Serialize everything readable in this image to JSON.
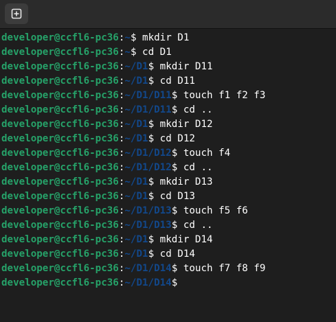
{
  "window": {
    "new_tab_icon": "new-tab-plus-icon"
  },
  "colors": {
    "background": "#1e1e1e",
    "prompt_user": "#26a269",
    "prompt_path": "#12488b",
    "text": "#ffffff"
  },
  "terminal": {
    "lines": [
      {
        "user": "developer@ccfl6-pc36",
        "path": "~",
        "sep": "$",
        "cmd": " mkdir D1"
      },
      {
        "user": "developer@ccfl6-pc36",
        "path": "~",
        "sep": "$",
        "cmd": " cd D1"
      },
      {
        "user": "developer@ccfl6-pc36",
        "path": "~/D1",
        "sep": "$",
        "cmd": " mkdir D11"
      },
      {
        "user": "developer@ccfl6-pc36",
        "path": "~/D1",
        "sep": "$",
        "cmd": " cd D11"
      },
      {
        "user": "developer@ccfl6-pc36",
        "path": "~/D1/D11",
        "sep": "$",
        "cmd": " touch f1 f2 f3"
      },
      {
        "user": "developer@ccfl6-pc36",
        "path": "~/D1/D11",
        "sep": "$",
        "cmd": " cd .."
      },
      {
        "user": "developer@ccfl6-pc36",
        "path": "~/D1",
        "sep": "$",
        "cmd": " mkdir D12"
      },
      {
        "user": "developer@ccfl6-pc36",
        "path": "~/D1",
        "sep": "$",
        "cmd": " cd D12"
      },
      {
        "user": "developer@ccfl6-pc36",
        "path": "~/D1/D12",
        "sep": "$",
        "cmd": " touch f4"
      },
      {
        "user": "developer@ccfl6-pc36",
        "path": "~/D1/D12",
        "sep": "$",
        "cmd": " cd .."
      },
      {
        "user": "developer@ccfl6-pc36",
        "path": "~/D1",
        "sep": "$",
        "cmd": " mkdir D13"
      },
      {
        "user": "developer@ccfl6-pc36",
        "path": "~/D1",
        "sep": "$",
        "cmd": " cd D13"
      },
      {
        "user": "developer@ccfl6-pc36",
        "path": "~/D1/D13",
        "sep": "$",
        "cmd": " touch f5 f6"
      },
      {
        "user": "developer@ccfl6-pc36",
        "path": "~/D1/D13",
        "sep": "$",
        "cmd": " cd .."
      },
      {
        "user": "developer@ccfl6-pc36",
        "path": "~/D1",
        "sep": "$",
        "cmd": " mkdir D14"
      },
      {
        "user": "developer@ccfl6-pc36",
        "path": "~/D1",
        "sep": "$",
        "cmd": " cd D14"
      },
      {
        "user": "developer@ccfl6-pc36",
        "path": "~/D1/D14",
        "sep": "$",
        "cmd": " touch f7 f8 f9"
      },
      {
        "user": "developer@ccfl6-pc36",
        "path": "~/D1/D14",
        "sep": "$",
        "cmd": ""
      }
    ]
  }
}
